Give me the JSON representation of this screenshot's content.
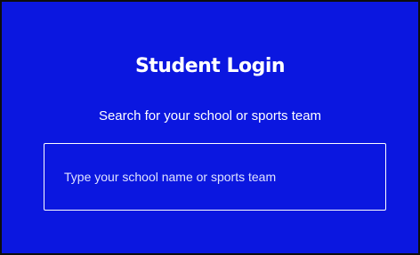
{
  "login": {
    "title": "Student Login",
    "subtitle": "Search for your school or sports team",
    "search": {
      "placeholder": "Type your school name or sports team",
      "value": ""
    }
  },
  "colors": {
    "background": "#0b17e0",
    "text": "#ffffff",
    "border": "#ffffff"
  }
}
